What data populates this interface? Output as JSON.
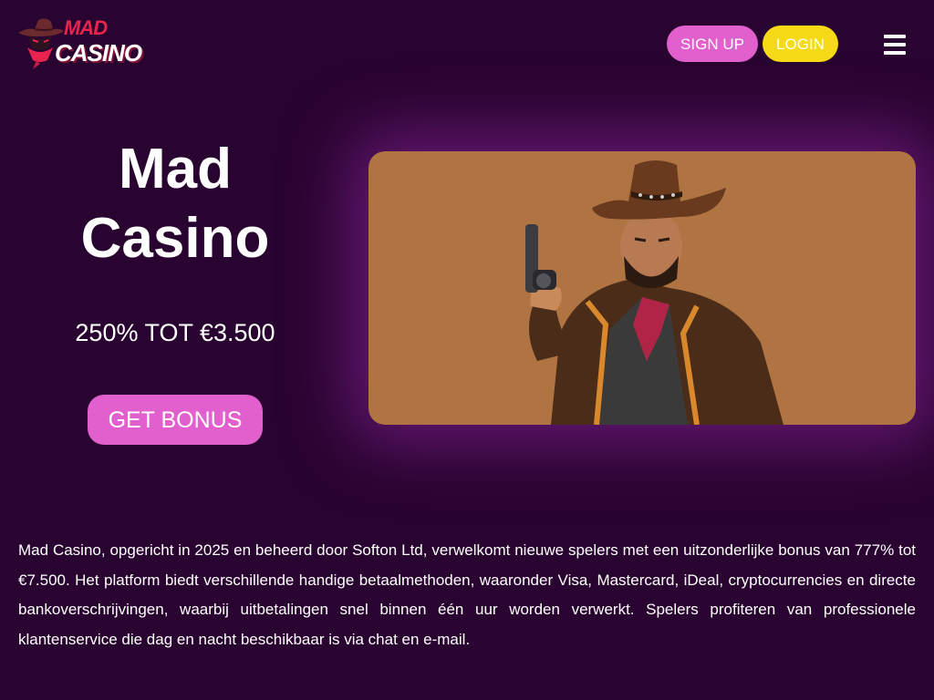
{
  "header": {
    "logo": {
      "line1": "MAD",
      "line2": "CASINO"
    },
    "signup_label": "SIGN UP",
    "login_label": "LOGIN",
    "menu_icon": "hamburger-menu-icon"
  },
  "hero": {
    "title": "Mad Casino",
    "offer": "250% TOT €3.500",
    "cta_label": "GET BONUS",
    "image": "cowboy-with-revolver-illustration"
  },
  "description": {
    "text": "Mad Casino, opgericht in 2025 en beheerd door Softon Ltd, verwelkomt nieuwe spelers met een uitzonderlijke bonus van 777% tot €7.500. Het platform biedt verschillende handige betaalmethoden, waaronder Visa, Mastercard, iDeal, cryptocurrencies en directe bankoverschrijvingen, waarbij uitbetalingen snel binnen één uur worden verwerkt. Spelers profiteren van professionele klantenservice die dag en nacht beschikbaar is via chat en e-mail."
  },
  "colors": {
    "background": "#2a0430",
    "accent_pink": "#e25fce",
    "accent_yellow": "#f6d917",
    "logo_red": "#e8244e",
    "image_background": "#b07442"
  }
}
